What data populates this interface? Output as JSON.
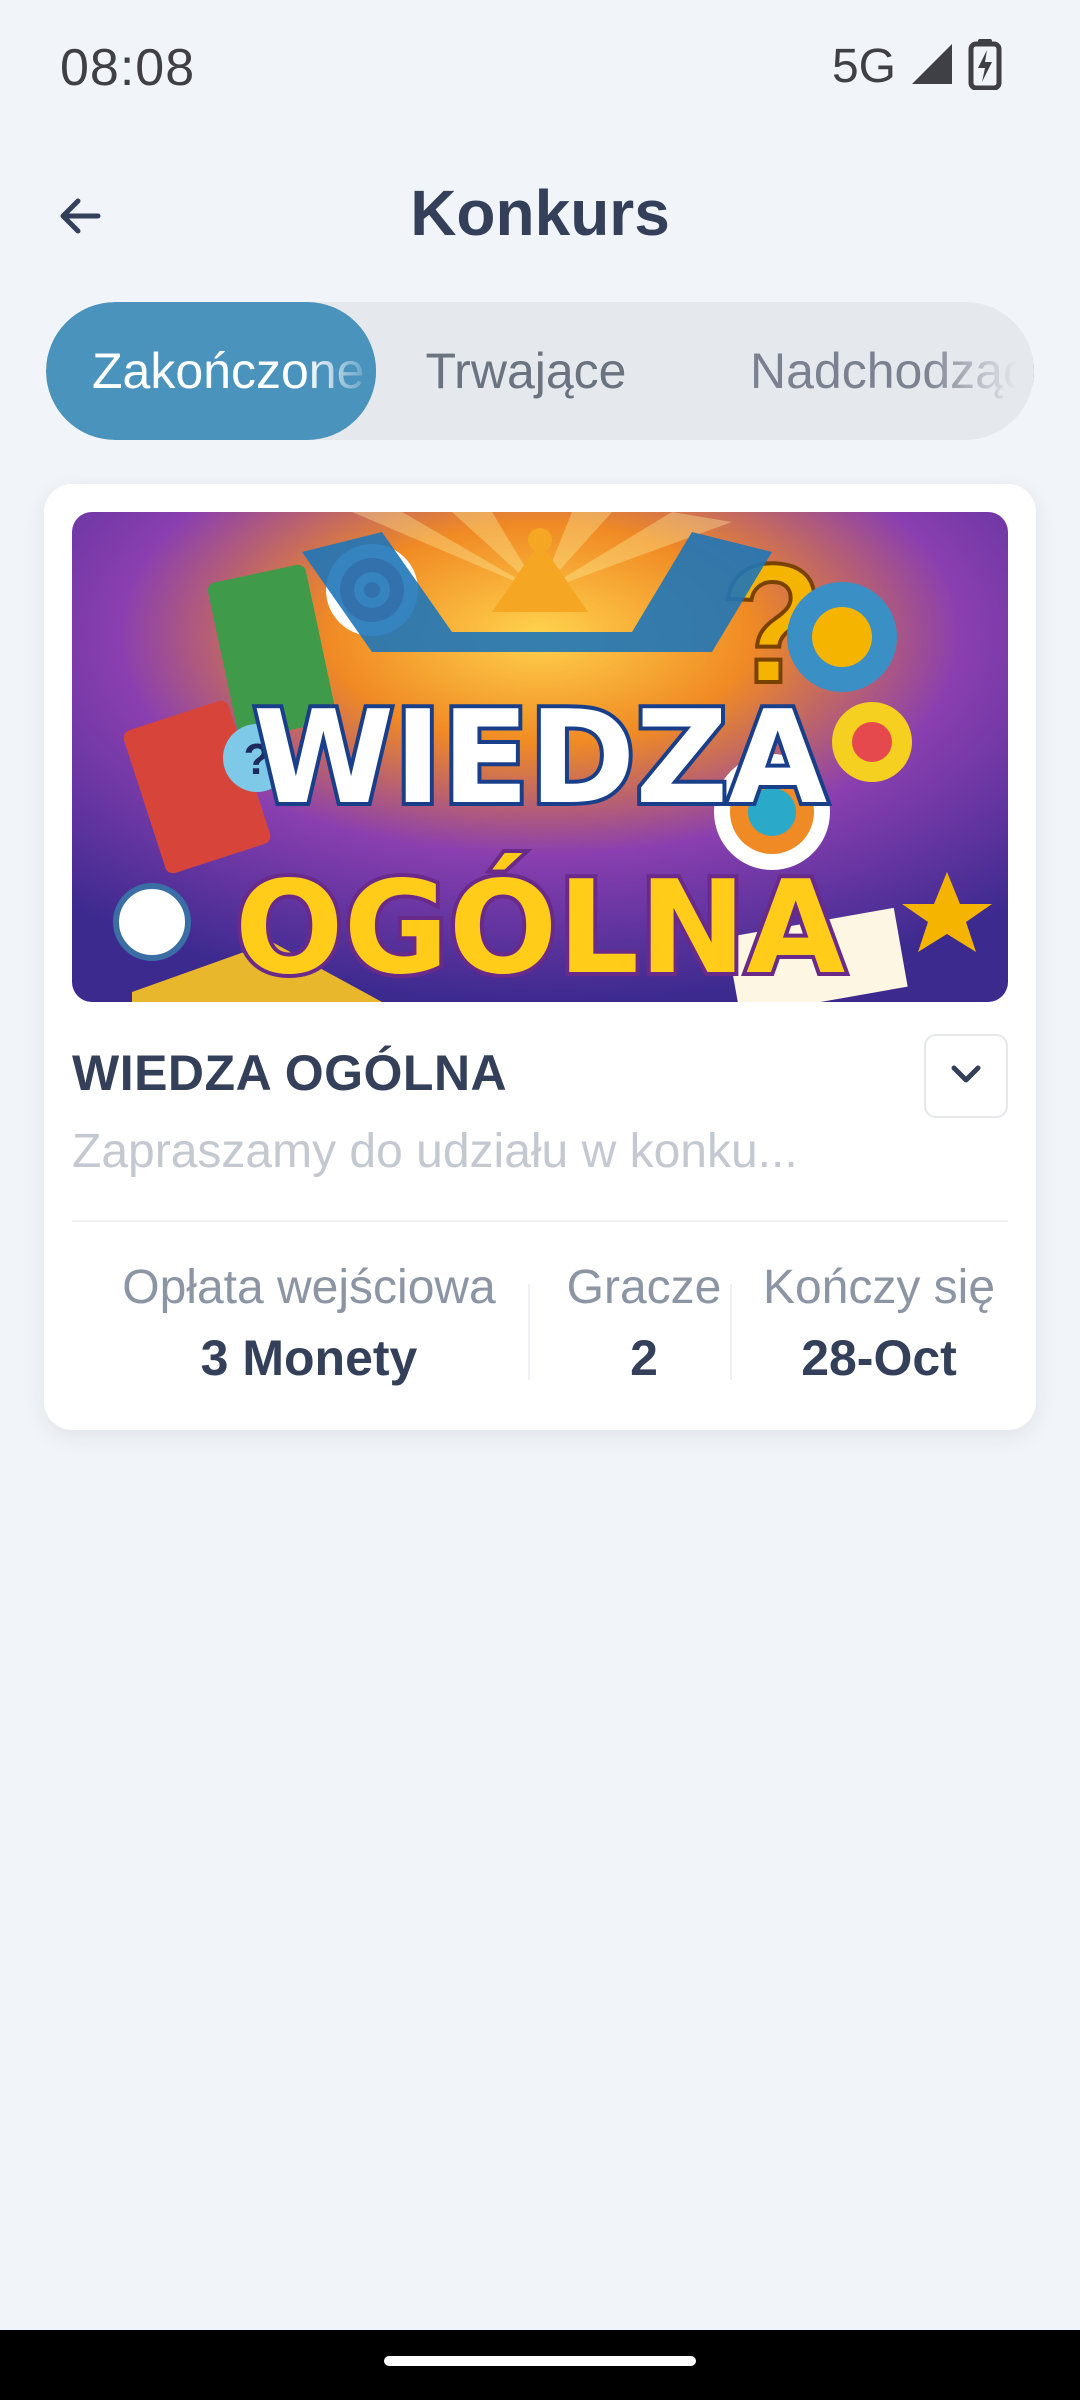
{
  "status_bar": {
    "time": "08:08",
    "network": "5G",
    "icons": [
      "signal-icon",
      "battery-charging-icon"
    ]
  },
  "header": {
    "title": "Konkurs",
    "back_icon": "arrow-left-icon"
  },
  "tabs": [
    {
      "label": "Zakończone",
      "active": true
    },
    {
      "label": "Trwające",
      "active": false
    },
    {
      "label": "Nadchodzące",
      "active": false
    }
  ],
  "contest": {
    "image_text_line1": "WIEDZA",
    "image_text_line2": "OGÓLNA",
    "title": "WIEDZA OGÓLNA",
    "description": "Zapraszamy do udziału w konku...",
    "expand_icon": "chevron-down-icon",
    "stats": {
      "fee_label": "Opłata wejściowa",
      "fee_value": "3 Monety",
      "players_label": "Gracze",
      "players_value": "2",
      "ends_label": "Kończy się",
      "ends_value": "28-Oct"
    }
  },
  "colors": {
    "background": "#f1f5f9",
    "accent": "#4a93bd",
    "title": "#34405a"
  }
}
